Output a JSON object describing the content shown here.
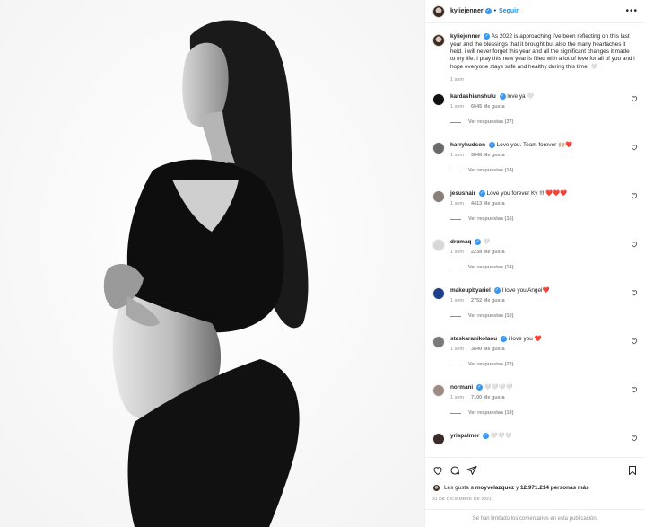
{
  "post": {
    "username": "kyliejenner",
    "follow_label": "Seguir",
    "separator": "•",
    "more_label": "•••"
  },
  "caption": {
    "username": "kyliejenner",
    "text": "As 2022 is approaching i've been reflecting on this last year and the blessings that it brought but also the many heartaches it held. i will never forget this year and all the significant changes it made to my life. I pray this new year is filled with a lot of love for all of you and i hope everyone stays safe and healthy during this time. 🤍",
    "time": "1 sem"
  },
  "comments": [
    {
      "username": "kardashianshulu",
      "text": "love ya 🤍",
      "time": "1 sem",
      "likes": "6645 Me gusta",
      "replies": "Ver respuestas (37)",
      "avatar_color": "#111111"
    },
    {
      "username": "harryhudson",
      "text": "Love you. Team forever 🙌🏼❤️",
      "time": "1 sem",
      "likes": "3848 Me gusta",
      "replies": "Ver respuestas (14)",
      "avatar_color": "#6b6b6b"
    },
    {
      "username": "jesushair",
      "text": "Love you forever Ky !!! ❤️❤️❤️",
      "time": "1 sem",
      "likes": "4413 Me gusta",
      "replies": "Ver respuestas (16)",
      "avatar_color": "#8a7f78"
    },
    {
      "username": "drumaq",
      "text": "🤍",
      "time": "1 sem",
      "likes": "2238 Me gusta",
      "replies": "Ver respuestas (14)",
      "avatar_color": "#d8d8d8"
    },
    {
      "username": "makeupbyariel",
      "text": "I love you Angel❤️",
      "time": "1 sem",
      "likes": "2752 Me gusta",
      "replies": "Ver respuestas (10)",
      "avatar_color": "#1c3f8c"
    },
    {
      "username": "staskaranikolaou",
      "text": "i love you ❤️",
      "time": "1 sem",
      "likes": "3840 Me gusta",
      "replies": "Ver respuestas (23)",
      "avatar_color": "#7a7a7a"
    },
    {
      "username": "normani",
      "text": "🤍🤍🤍🤍",
      "time": "1 sem",
      "likes": "7100 Me gusta",
      "replies": "Ver respuestas (19)",
      "avatar_color": "#9e8c84"
    },
    {
      "username": "yrispalmer",
      "text": "🤍🤍🤍",
      "time": "",
      "likes": "",
      "replies": "",
      "avatar_color": "#3a2b2b"
    }
  ],
  "actions": {
    "likes_prefix": "Les gusta a",
    "liker": "moyvelazquez",
    "likes_middle": "y",
    "likes_count": "12.971.214 personas más",
    "date": "31 DE DICIEMBRE DE 2021",
    "limited_notice": "Se han limitado los comentarios en esta publicación."
  },
  "colors": {
    "accent": "#0095f6",
    "verified": "#3897f0",
    "muted": "#8e8e8e",
    "like_heart": "#262626"
  }
}
